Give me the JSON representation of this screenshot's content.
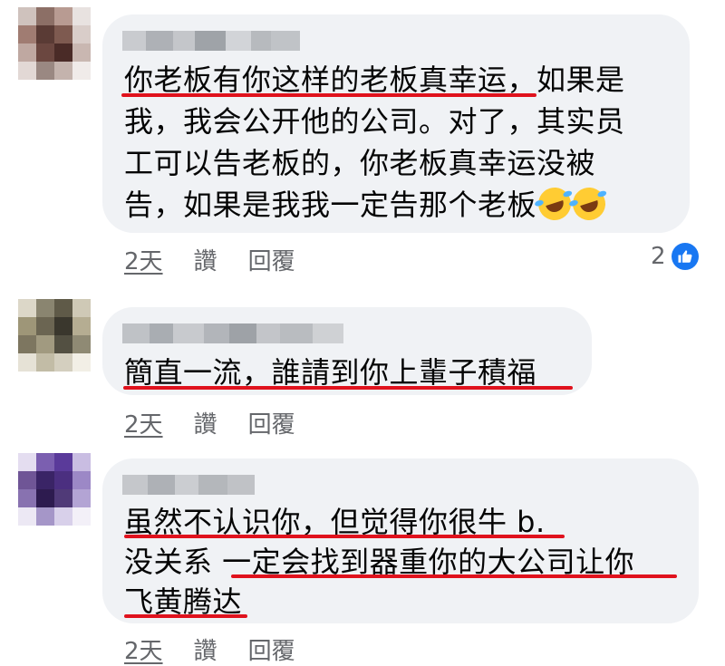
{
  "comments": [
    {
      "text_lines": [
        "你老板有你这样的老板真幸运，如果是",
        "我，我会公开他的公司。对了，其实员",
        "工可以告老板的，你老板真幸运没被",
        "告，如果是我我一定告那个老板"
      ],
      "emoji": [
        "rolling-on-floor-laughing",
        "rolling-on-floor-laughing"
      ],
      "time": "2天",
      "like_label": "讚",
      "reply_label": "回覆",
      "reaction_count": "2",
      "reaction_icon": "thumbs-up-icon",
      "avatar_colors": [
        "#cfc2bd",
        "#8c6f66",
        "#b89b92",
        "#e8e2e0",
        "#a07c72",
        "#5a3b35",
        "#7e5a50",
        "#d9cdc9",
        "#bfa8a1",
        "#6b4740",
        "#4a2b27",
        "#c9b7b1",
        "#e2d8d5",
        "#9a8882",
        "#c4b3ad",
        "#f0ebe9"
      ]
    },
    {
      "text_lines": [
        "簡直一流，誰請到你上輩子積福"
      ],
      "time": "2天",
      "like_label": "讚",
      "reply_label": "回覆",
      "avatar_colors": [
        "#dcd7c8",
        "#8a8570",
        "#5f5a48",
        "#cfc9b6",
        "#9e9678",
        "#6b6552",
        "#3a372d",
        "#b5ad92",
        "#7d7660",
        "#a19a80",
        "#535042",
        "#8f8a74",
        "#e6e2d6",
        "#c2bca6",
        "#d4cfbf",
        "#f2efe6"
      ]
    },
    {
      "text_lines": [
        "虽然不认识你，但觉得你很牛 b.",
        "没关系 一定会找到器重你的大公司让你",
        "飞黄腾达"
      ],
      "time": "2天",
      "like_label": "讚",
      "reply_label": "回覆",
      "avatar_colors": [
        "#e4ddf0",
        "#7b5fb0",
        "#5a3a9a",
        "#c9bde2",
        "#6f5596",
        "#3a2466",
        "#4b2f80",
        "#9c88c6",
        "#8872b0",
        "#2d1b4f",
        "#503a78",
        "#b3a4d4",
        "#ece8f4",
        "#a596c8",
        "#d8d0ea",
        "#f3f0f8"
      ]
    }
  ],
  "colors": {
    "underline": "#e0121d",
    "bubble": "#f0f2f5",
    "meta_text": "#65676b",
    "reaction_blue": "#1877f2"
  }
}
